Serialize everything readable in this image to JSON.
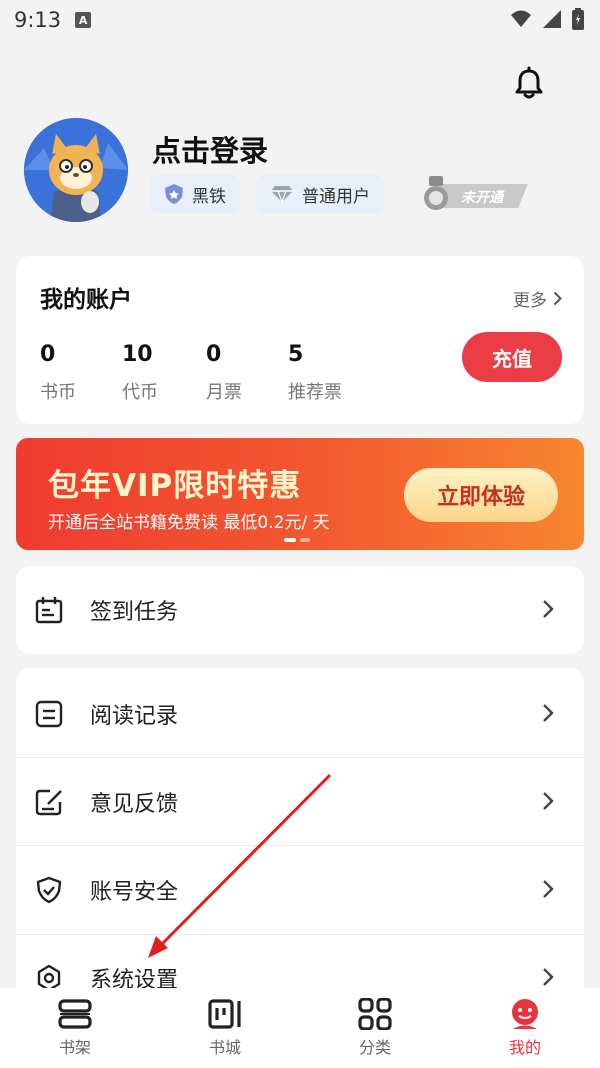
{
  "status_bar": {
    "time": "9:13",
    "indicator": "A",
    "icons": [
      "wifi-icon",
      "signal-icon",
      "battery-icon"
    ]
  },
  "header": {
    "notification_icon": "bell-icon"
  },
  "profile": {
    "login_text": "点击登录",
    "tags": [
      {
        "label": "黑铁",
        "icon": "shield-badge-icon"
      },
      {
        "label": "普通用户",
        "icon": "diamond-icon"
      }
    ],
    "vip_badge": "未开通"
  },
  "account": {
    "title": "我的账户",
    "more": "更多",
    "stats": [
      {
        "value": "0",
        "label": "书币"
      },
      {
        "value": "10",
        "label": "代币"
      },
      {
        "value": "0",
        "label": "月票"
      },
      {
        "value": "5",
        "label": "推荐票"
      }
    ],
    "recharge": "充值"
  },
  "banner": {
    "title": "包年VIP限时特惠",
    "subtitle": "开通后全站书籍免费读 最低0.2元/ 天",
    "button": "立即体验"
  },
  "menu": {
    "group1": [
      {
        "label": "签到任务",
        "icon": "calendar-icon"
      }
    ],
    "group2": [
      {
        "label": "阅读记录",
        "icon": "document-icon"
      },
      {
        "label": "意见反馈",
        "icon": "edit-icon"
      },
      {
        "label": "账号安全",
        "icon": "shield-check-icon"
      },
      {
        "label": "系统设置",
        "icon": "settings-icon"
      }
    ]
  },
  "tabbar": [
    {
      "label": "书架",
      "icon": "bookshelf-icon"
    },
    {
      "label": "书城",
      "icon": "bookstore-icon"
    },
    {
      "label": "分类",
      "icon": "category-grid-icon"
    },
    {
      "label": "我的",
      "icon": "profile-icon"
    }
  ],
  "colors": {
    "accent": "#e8343e",
    "banner_start": "#ef3b30",
    "banner_end": "#f7862f"
  }
}
